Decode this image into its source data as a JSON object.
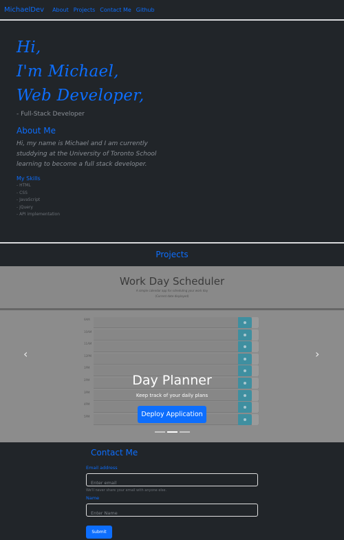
{
  "nav": {
    "brand": "MichaelDev",
    "links": [
      "About",
      "Projects",
      "Contact Me",
      "Github"
    ]
  },
  "hero": {
    "greeting": "Hi,",
    "name_line": "I'm Michael,",
    "role_line": "Web Developer,",
    "subtitle": "- Full-Stack Developer"
  },
  "about": {
    "heading": "About Me",
    "paragraph": "Hi, my name is Michael and I am currently studdying at the University of Toronto School learning to become a full stack developer."
  },
  "skills": {
    "heading": "My Skills",
    "items": [
      "- HTML",
      "- CSS",
      "- JavaScript",
      "- jQuery",
      "- API implementation"
    ]
  },
  "projects": {
    "heading": "Projects",
    "slide": {
      "screenshot_title": "Work Day Scheduler",
      "screenshot_subtitle": "A simple calendar app for scheduling your work day",
      "screenshot_date": "(Current date displayed)",
      "hours": [
        "9AM",
        "10AM",
        "11AM",
        "12PM",
        "1PM",
        "2PM",
        "3PM",
        "4PM",
        "5PM"
      ],
      "caption_title": "Day Planner",
      "caption_text": "Keep track of your daily plans",
      "button_label": "Deploy Application"
    },
    "indicator_count": 3,
    "active_indicator": 2,
    "prev_glyph": "‹",
    "next_glyph": "›"
  },
  "contact": {
    "heading": "Contact Me",
    "email_label": "Email address",
    "email_placeholder": "Enter email",
    "email_help": "We'll never share your email with anyone else.",
    "name_label": "Name",
    "name_placeholder": "Enter Name",
    "submit_label": "Submit"
  },
  "colors": {
    "accent": "#0d6efd",
    "background": "#212529",
    "carousel_bg": "#8c8c8c",
    "save_button": "#3f8fa0"
  }
}
